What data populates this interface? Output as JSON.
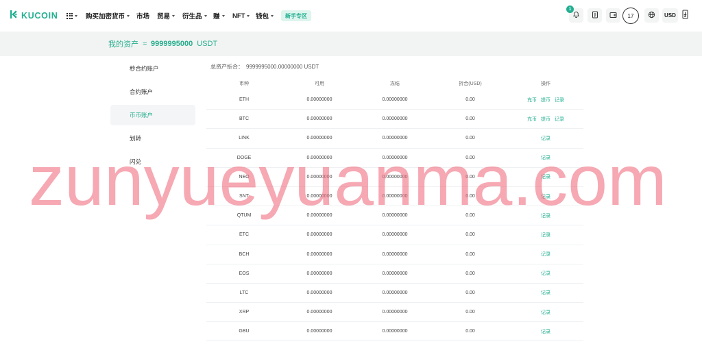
{
  "header": {
    "logo": {
      "text": "KUCOIN",
      "icon": "kucoin-logo-icon"
    },
    "grid_menu": {
      "icon": "grid-icon",
      "dropdown": true
    },
    "nav": [
      {
        "label": "购买加密货币",
        "dropdown": true
      },
      {
        "label": "市场",
        "dropdown": false
      },
      {
        "label": "贸易",
        "dropdown": true
      },
      {
        "label": "衍生品",
        "dropdown": true
      },
      {
        "label": "赚",
        "dropdown": true
      },
      {
        "label": "NFT",
        "dropdown": true
      },
      {
        "label": "钱包",
        "dropdown": true
      }
    ],
    "newbie_zone": "新手专区",
    "notifications": {
      "icon": "bell-icon",
      "count": "1"
    },
    "orders_icon": "document-icon",
    "wallet_icon": "wallet-icon",
    "user_badge": "17",
    "language_icon": "globe-icon",
    "currency": "USD",
    "app_download_icon": "phone-download-icon"
  },
  "assets_summary": {
    "label": "我的资产",
    "approx": "≈",
    "amount": "9999995000",
    "unit": "USDT"
  },
  "sidebar": {
    "items": [
      {
        "label": "秒合约账户"
      },
      {
        "label": "合约账户"
      },
      {
        "label": "币币账户",
        "selected": true
      },
      {
        "label": "划转"
      },
      {
        "label": "闪兑"
      }
    ]
  },
  "total": {
    "label": "总资产折合：",
    "value": "9999995000.00000000 USDT"
  },
  "table": {
    "columns": [
      "币种",
      "可用",
      "冻结",
      "折合(USD)",
      "操作"
    ],
    "rows": [
      {
        "coin": "ETH",
        "available": "0.00000000",
        "frozen": "0.00000000",
        "usd_value": "0.00",
        "actions": [
          "充币",
          "提币",
          "记录"
        ]
      },
      {
        "coin": "BTC",
        "available": "0.00000000",
        "frozen": "0.00000000",
        "usd_value": "0.00",
        "actions": [
          "充币",
          "提币",
          "记录"
        ]
      },
      {
        "coin": "LINK",
        "available": "0.00000000",
        "frozen": "0.00000000",
        "usd_value": "0.00",
        "actions": [
          "记录"
        ]
      },
      {
        "coin": "DOGE",
        "available": "0.00000000",
        "frozen": "0.00000000",
        "usd_value": "0.00",
        "actions": [
          "记录"
        ]
      },
      {
        "coin": "NEO",
        "available": "0.00000000",
        "frozen": "0.00000000",
        "usd_value": "0.00",
        "actions": [
          "记录"
        ]
      },
      {
        "coin": "SNT",
        "available": "0.00000000",
        "frozen": "0.00000000",
        "usd_value": "0.00",
        "actions": [
          "记录"
        ]
      },
      {
        "coin": "QTUM",
        "available": "0.00000000",
        "frozen": "0.00000000",
        "usd_value": "0.00",
        "actions": [
          "记录"
        ]
      },
      {
        "coin": "ETC",
        "available": "0.00000000",
        "frozen": "0.00000000",
        "usd_value": "0.00",
        "actions": [
          "记录"
        ]
      },
      {
        "coin": "BCH",
        "available": "0.00000000",
        "frozen": "0.00000000",
        "usd_value": "0.00",
        "actions": [
          "记录"
        ]
      },
      {
        "coin": "EOS",
        "available": "0.00000000",
        "frozen": "0.00000000",
        "usd_value": "0.00",
        "actions": [
          "记录"
        ]
      },
      {
        "coin": "LTC",
        "available": "0.00000000",
        "frozen": "0.00000000",
        "usd_value": "0.00",
        "actions": [
          "记录"
        ]
      },
      {
        "coin": "XRP",
        "available": "0.00000000",
        "frozen": "0.00000000",
        "usd_value": "0.00",
        "actions": [
          "记录"
        ]
      },
      {
        "coin": "GBU",
        "available": "0.00000000",
        "frozen": "0.00000000",
        "usd_value": "0.00",
        "actions": [
          "记录"
        ]
      }
    ]
  },
  "watermark": "zunyueyuanma.com",
  "colors": {
    "brand_green": "#23af91",
    "band_background": "#f2f4f3",
    "selected_background": "#f4f5f7",
    "watermark_pink": "#f4a0aa"
  }
}
